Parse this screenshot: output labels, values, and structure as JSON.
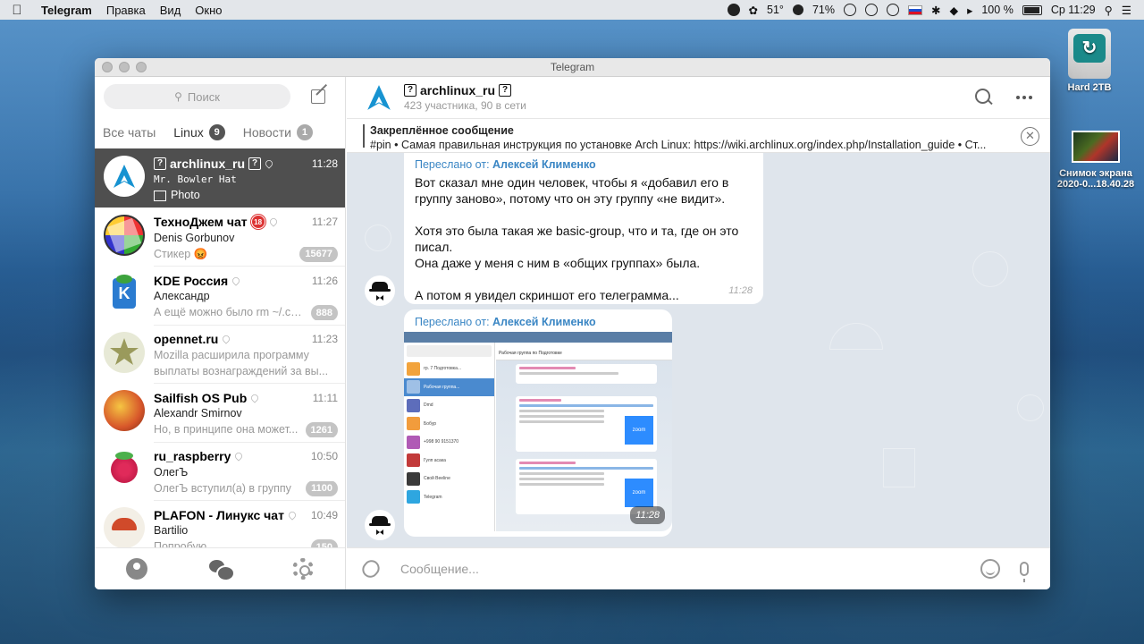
{
  "menubar": {
    "app": "Telegram",
    "items": [
      "Правка",
      "Вид",
      "Окно"
    ],
    "temperature": "51°",
    "cpu": "71%",
    "battery": "100 %",
    "clock": "Ср 11:29"
  },
  "desktop": {
    "drive_label": "Hard 2TB",
    "screenshot_label_1": "Снимок экрана",
    "screenshot_label_2": "2020-0...18.40.28"
  },
  "window": {
    "title": "Telegram"
  },
  "sidebar": {
    "search_placeholder": "Поиск",
    "folders": [
      {
        "label": "Все чаты",
        "badge": ""
      },
      {
        "label": "Linux",
        "badge": "9"
      },
      {
        "label": "Новости",
        "badge": "1"
      }
    ],
    "chats": [
      {
        "name": "archlinux_ru",
        "time": "11:28",
        "line1": "Mr. Bowler Hat",
        "line2": "Photo",
        "badge": ""
      },
      {
        "name": "ТехноДжем чат",
        "time": "11:27",
        "line1": "Denis Gorbunov",
        "line2": "Стикер 😡",
        "badge": "15677",
        "age": "18"
      },
      {
        "name": "KDE Россия",
        "time": "11:26",
        "line1": "Александр",
        "line2": "А ещё можно было rm ~/.co...",
        "badge": "888"
      },
      {
        "name": "opennet.ru",
        "time": "11:23",
        "line1": "Mozilla расширила программу",
        "line2": "выплаты вознаграждений за вы...",
        "badge": ""
      },
      {
        "name": "Sailfish OS Pub",
        "time": "11:11",
        "line1": "Alexandr Smirnov",
        "line2": "Но, в принципе она может...",
        "badge": "1261"
      },
      {
        "name": "ru_raspberry",
        "time": "10:50",
        "line1": "ОлегЪ",
        "line2": "ОлегЪ вступил(а) в группу",
        "badge": "1100"
      },
      {
        "name": "PLAFON - Линукс чат",
        "time": "10:49",
        "line1": "Bartilio",
        "line2": "Попробую",
        "badge": "150"
      }
    ]
  },
  "chat": {
    "title": "archlinux_ru",
    "subtitle": "423 участника, 90 в сети",
    "pinned_title": "Закреплённое сообщение",
    "pinned_text": "#pin • Самая правильная инструкция по установке Arch Linux: https://wiki.archlinux.org/index.php/Installation_guide • Ст...",
    "messages": [
      {
        "forward_prefix": "Переслано от:",
        "forward_name": "Алексей Клименко",
        "paragraphs": [
          "Вот сказал мне один человек, чтобы я «добавил его в группу заново», потому что он эту группу «не видит».",
          "Хотя это была такая же basic-group, что и та, где он это писал.\nОна даже у меня с ним в «общих группах» была.",
          "А потом я увидел скриншот его телеграмма..."
        ],
        "time": "11:28"
      },
      {
        "forward_prefix": "Переслано от:",
        "forward_name": "Алексей Клименко",
        "time": "11:28"
      }
    ],
    "composer_placeholder": "Сообщение..."
  }
}
